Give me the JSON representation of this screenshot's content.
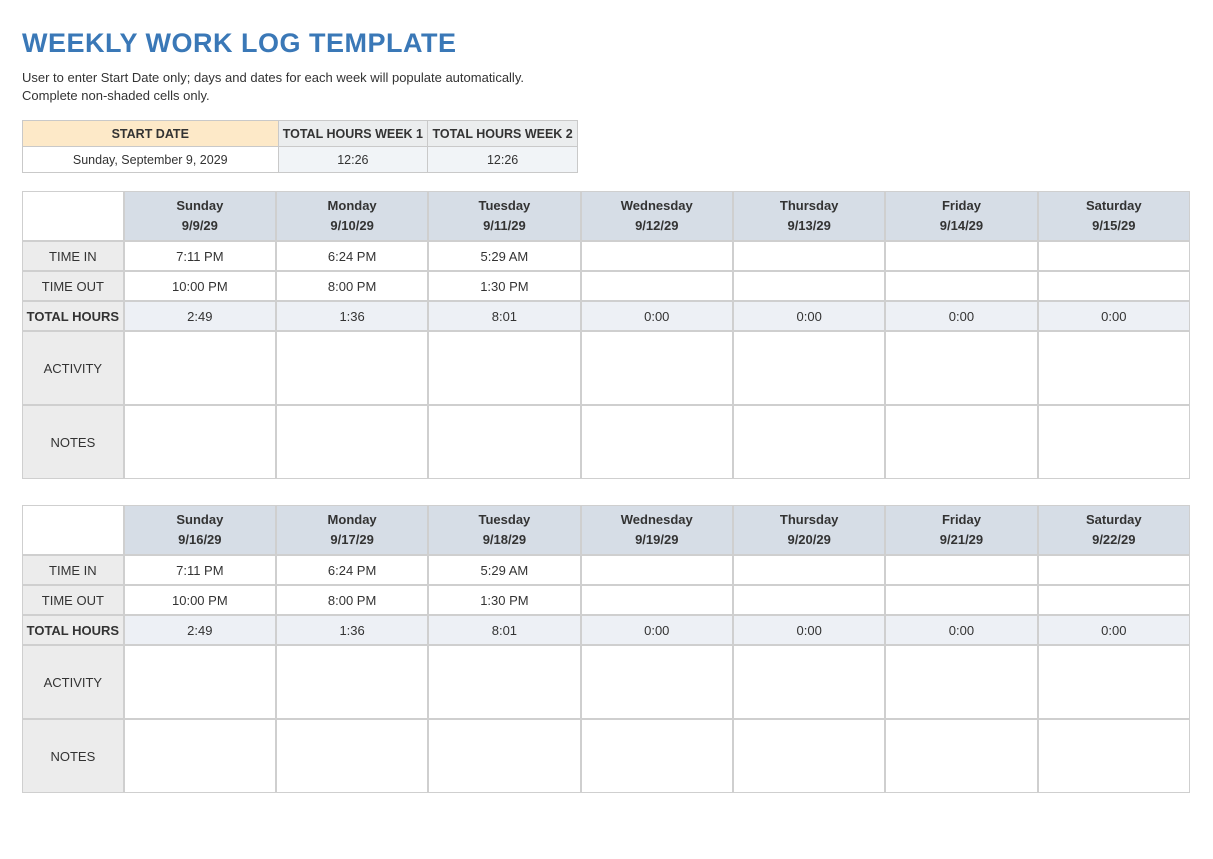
{
  "title": "WEEKLY WORK LOG TEMPLATE",
  "instructions_line1": "User to enter Start Date only; days and dates for each week will populate automatically.",
  "instructions_line2": "Complete non-shaded cells only.",
  "summary": {
    "headers": {
      "start": "START DATE",
      "tw1": "TOTAL HOURS WEEK 1",
      "tw2": "TOTAL HOURS WEEK 2"
    },
    "values": {
      "start": "Sunday, September 9, 2029",
      "tw1": "12:26",
      "tw2": "12:26"
    }
  },
  "row_labels": {
    "time_in": "TIME IN",
    "time_out": "TIME OUT",
    "total_hours": "TOTAL HOURS",
    "activity": "ACTIVITY",
    "notes": "NOTES"
  },
  "weeks": [
    {
      "days": [
        "Sunday",
        "Monday",
        "Tuesday",
        "Wednesday",
        "Thursday",
        "Friday",
        "Saturday"
      ],
      "dates": [
        "9/9/29",
        "9/10/29",
        "9/11/29",
        "9/12/29",
        "9/13/29",
        "9/14/29",
        "9/15/29"
      ],
      "time_in": [
        "7:11 PM",
        "6:24 PM",
        "5:29 AM",
        "",
        "",
        "",
        ""
      ],
      "time_out": [
        "10:00 PM",
        "8:00 PM",
        "1:30 PM",
        "",
        "",
        "",
        ""
      ],
      "total": [
        "2:49",
        "1:36",
        "8:01",
        "0:00",
        "0:00",
        "0:00",
        "0:00"
      ],
      "activity": [
        "",
        "",
        "",
        "",
        "",
        "",
        ""
      ],
      "notes": [
        "",
        "",
        "",
        "",
        "",
        "",
        ""
      ]
    },
    {
      "days": [
        "Sunday",
        "Monday",
        "Tuesday",
        "Wednesday",
        "Thursday",
        "Friday",
        "Saturday"
      ],
      "dates": [
        "9/16/29",
        "9/17/29",
        "9/18/29",
        "9/19/29",
        "9/20/29",
        "9/21/29",
        "9/22/29"
      ],
      "time_in": [
        "7:11 PM",
        "6:24 PM",
        "5:29 AM",
        "",
        "",
        "",
        ""
      ],
      "time_out": [
        "10:00 PM",
        "8:00 PM",
        "1:30 PM",
        "",
        "",
        "",
        ""
      ],
      "total": [
        "2:49",
        "1:36",
        "8:01",
        "0:00",
        "0:00",
        "0:00",
        "0:00"
      ],
      "activity": [
        "",
        "",
        "",
        "",
        "",
        "",
        ""
      ],
      "notes": [
        "",
        "",
        "",
        "",
        "",
        "",
        ""
      ]
    }
  ]
}
